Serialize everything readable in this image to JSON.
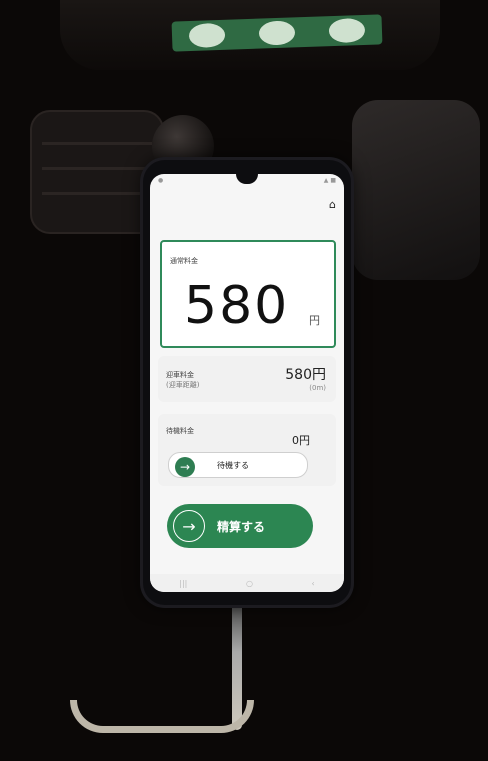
{
  "app": {
    "regular_fare_label": "通常料金",
    "regular_fare_value": "580",
    "currency": "円",
    "pickup_fare_label": "迎車料金",
    "pickup_distance_label": "(迎車距離)",
    "pickup_fare_value": "580円",
    "pickup_distance_value": "(0m)",
    "waiting_fare_label": "待機料金",
    "waiting_fare_value": "0円",
    "wait_button_label": "待機する",
    "settle_button_label": "精算する"
  },
  "icons": {
    "home": "home-icon",
    "wait_arrow": "arrow-right-icon",
    "settle_arrow": "arrow-right-icon"
  },
  "colors": {
    "accent": "#2c8652",
    "card_border": "#2f8a5a",
    "background": "#0b0807"
  }
}
